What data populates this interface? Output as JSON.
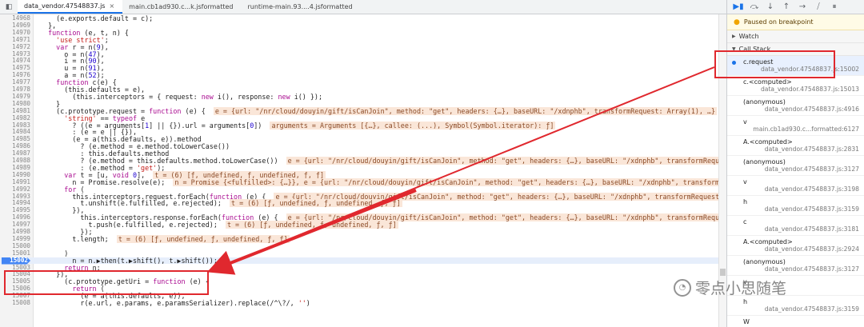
{
  "tabs": [
    {
      "label": "data_vendor.47548837.js",
      "active": true
    },
    {
      "label": "main.cb1ad930.c...k.jsformatted",
      "active": false
    },
    {
      "label": "runtime-main.93....4.jsformatted",
      "active": false
    }
  ],
  "close_glyph": "×",
  "lines": [
    {
      "n": "14968",
      "code": "    (e.exports.default = c);"
    },
    {
      "n": "14969",
      "code": "  },"
    },
    {
      "n": "14970",
      "code": "  function (e, t, n) {"
    },
    {
      "n": "14971",
      "code": "    'use strict';"
    },
    {
      "n": "14972",
      "code": "    var r = n(9),"
    },
    {
      "n": "14973",
      "code": "      o = n(47),"
    },
    {
      "n": "14974",
      "code": "      i = n(90),"
    },
    {
      "n": "14975",
      "code": "      u = n(91),"
    },
    {
      "n": "14976",
      "code": "      a = n(52);"
    },
    {
      "n": "14977",
      "code": "    function c(e) {"
    },
    {
      "n": "14978",
      "code": "      (this.defaults = e),"
    },
    {
      "n": "14979",
      "code": "        (this.interceptors = { request: new i(), response: new i() });"
    },
    {
      "n": "14980",
      "code": "    }"
    },
    {
      "n": "14981",
      "code": "    (c.prototype.request = function (e) {",
      "inline": "e = {url: \"/nr/cloud/douyin/gift/isCanJoin\", method: \"get\", headers: {…}, baseURL: \"/xdnphb\", transformRequest: Array(1), …}"
    },
    {
      "n": "14982",
      "code": "      'string' == typeof e"
    },
    {
      "n": "14983",
      "code": "        ? ((e = arguments[1] || {}).url = arguments[0])",
      "inline": "arguments = Arguments [{…}, callee: (...), Symbol(Symbol.iterator): ƒ]"
    },
    {
      "n": "14984",
      "code": "        : (e = e || {}),"
    },
    {
      "n": "14985",
      "code": "        (e = a(this.defaults, e)).method"
    },
    {
      "n": "14986",
      "code": "          ? (e.method = e.method.toLowerCase())"
    },
    {
      "n": "14987",
      "code": "          : this.defaults.method"
    },
    {
      "n": "14988",
      "code": "          ? (e.method = this.defaults.method.toLowerCase())",
      "inline": "e = {url: \"/nr/cloud/douyin/gift/isCanJoin\", method: \"get\", headers: {…}, baseURL: \"/xdnphb\", transformRequest: Array(1), …}"
    },
    {
      "n": "14989",
      "code": "          : (e.method = 'get');"
    },
    {
      "n": "14990",
      "code": "      var t = [u, void 0],",
      "inline": "t = (6) [ƒ, undefined, ƒ, undefined, ƒ, ƒ]"
    },
    {
      "n": "14991",
      "code": "        n = Promise.resolve(e);",
      "inline": "n = Promise {<fulfilled>: {…}}, e = {url: \"/nr/cloud/douyin/gift/isCanJoin\", method: \"get\", headers: {…}, baseURL: \"/xdnphb\", transformRequest: Array…"
    },
    {
      "n": "14992",
      "code": "      for ("
    },
    {
      "n": "14993",
      "code": "        this.interceptors.request.forEach(function (e) {",
      "inline": "e = {url: \"/nr/cloud/douyin/gift/isCanJoin\", method: \"get\", headers: {…}, baseURL: \"/xdnphb\", transformRequest: Array(1), …}"
    },
    {
      "n": "14994",
      "code": "          t.unshift(e.fulfilled, e.rejected);",
      "inline": "t = (6) [ƒ, undefined, ƒ, undefined, ƒ, ƒ]"
    },
    {
      "n": "14995",
      "code": "        }),"
    },
    {
      "n": "14996",
      "code": "          this.interceptors.response.forEach(function (e) {",
      "inline": "e = {url: \"/nr/cloud/douyin/gift/isCanJoin\", method: \"get\", headers: {…}, baseURL: \"/xdnphb\", transformRequest: Array(1), …}"
    },
    {
      "n": "14997",
      "code": "            t.push(e.fulfilled, e.rejected);",
      "inline": "t = (6) [ƒ, undefined, ƒ, undefined, ƒ, ƒ]"
    },
    {
      "n": "14998",
      "code": "          });"
    },
    {
      "n": "14999",
      "code": "        t.length;",
      "inline": "t = (6) [ƒ, undefined, ƒ, undefined, ƒ, ƒ]"
    },
    {
      "n": "15000",
      "code": ""
    },
    {
      "n": "15001",
      "code": "      )"
    },
    {
      "n": "15002",
      "code": "        n = n.▶then(t.▶shift(), t.▶shift());",
      "breakpoint": true
    },
    {
      "n": "15003",
      "code": "      return n;"
    },
    {
      "n": "15004",
      "code": "    }),"
    },
    {
      "n": "15005",
      "code": "      (c.prototype.getUri = function (e) {"
    },
    {
      "n": "15006",
      "code": "        return ("
    },
    {
      "n": "15007",
      "code": "          (e = a(this.defaults, e)),"
    },
    {
      "n": "15008",
      "code": "          r(e.url, e.params, e.paramsSerializer).replace(/^\\?/, '')"
    }
  ],
  "debug_toolbar": [
    {
      "name": "resume-button",
      "glyph": "▶▮",
      "blue": true
    },
    {
      "name": "step-over-button",
      "glyph": "⤼",
      "blue": false
    },
    {
      "name": "step-into-button",
      "glyph": "↓",
      "blue": false
    },
    {
      "name": "step-out-button",
      "glyph": "↑",
      "blue": false
    },
    {
      "name": "step-button",
      "glyph": "→",
      "blue": false
    },
    {
      "name": "deactivate-breakpoints-button",
      "glyph": "⧸",
      "blue": false
    },
    {
      "name": "pause-on-exceptions-button",
      "glyph": "⏸",
      "blue": false
    }
  ],
  "paused_text": "Paused on breakpoint",
  "watch_label": "Watch",
  "call_stack_label": "Call Stack",
  "call_stack": [
    {
      "name": "c.request",
      "loc": "data_vendor.47548837.js:15002",
      "selected": true
    },
    {
      "name": "c.<computed>",
      "loc": "data_vendor.47548837.js:15013"
    },
    {
      "name": "(anonymous)",
      "loc": "data_vendor.47548837.js:4916"
    },
    {
      "name": "v",
      "loc": "main.cb1ad930.c...formatted:6127"
    },
    {
      "name": "A.<computed>",
      "loc": "data_vendor.47548837.js:2831"
    },
    {
      "name": "(anonymous)",
      "loc": "data_vendor.47548837.js:3127"
    },
    {
      "name": "v",
      "loc": "data_vendor.47548837.js:3198"
    },
    {
      "name": "h",
      "loc": "data_vendor.47548837.js:3159"
    },
    {
      "name": "c",
      "loc": "data_vendor.47548837.js:3181"
    },
    {
      "name": "A.<computed>",
      "loc": "data_vendor.47548837.js:2924"
    },
    {
      "name": "(anonymous)",
      "loc": "data_vendor.47548837.js:3127"
    },
    {
      "name": "v",
      "loc": ""
    },
    {
      "name": "h",
      "loc": "data_vendor.47548837.js:3159"
    },
    {
      "name": "W",
      "loc": ""
    }
  ],
  "watermark": "零点小思随笔",
  "annotation_color": "#e0282e"
}
